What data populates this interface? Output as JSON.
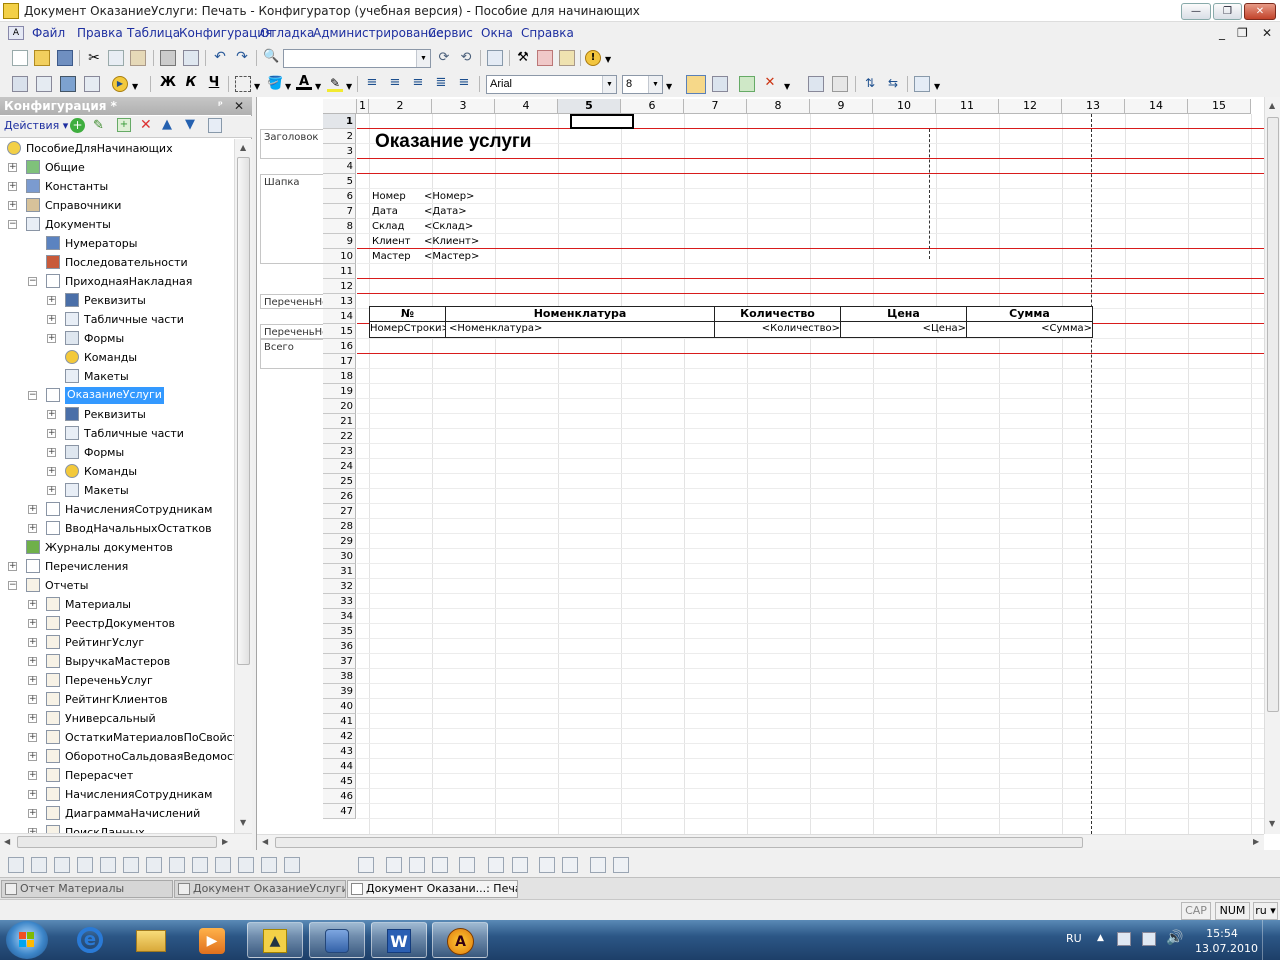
{
  "window": {
    "title": "Документ ОказаниеУслуги: Печать - Конфигуратор (учебная версия) - Пособие для начинающих"
  },
  "menu": [
    "Файл",
    "Правка",
    "Таблица",
    "Конфигурация",
    "Отладка",
    "Администрирование",
    "Сервис",
    "Окна",
    "Справка"
  ],
  "format_toolbar": {
    "font_name": "Arial",
    "font_size": "8",
    "bold": "Ж",
    "italic": "К",
    "underline": "Ч"
  },
  "panel": {
    "title": "Конфигурация *",
    "actions_label": "Действия",
    "tree": [
      {
        "label": "ПособиеДляНачинающих",
        "level": 0,
        "icon": "config-icon"
      },
      {
        "label": "Общие",
        "level": 1,
        "toggle": "+",
        "icon": "common-icon"
      },
      {
        "label": "Константы",
        "level": 1,
        "toggle": "+",
        "icon": "constants-icon"
      },
      {
        "label": "Справочники",
        "level": 1,
        "toggle": "+",
        "icon": "catalogs-icon"
      },
      {
        "label": "Документы",
        "level": 1,
        "toggle": "−",
        "icon": "documents-icon"
      },
      {
        "label": "Нумераторы",
        "level": 2,
        "icon": "numerators-icon"
      },
      {
        "label": "Последовательности",
        "level": 2,
        "icon": "sequences-icon"
      },
      {
        "label": "ПриходнаяНакладная",
        "level": 2,
        "toggle": "−",
        "icon": "document-icon"
      },
      {
        "label": "Реквизиты",
        "level": 3,
        "toggle": "+",
        "icon": "attributes-icon"
      },
      {
        "label": "Табличные части",
        "level": 3,
        "toggle": "+",
        "icon": "tabular-icon"
      },
      {
        "label": "Формы",
        "level": 3,
        "toggle": "+",
        "icon": "forms-icon"
      },
      {
        "label": "Команды",
        "level": 3,
        "icon": "commands-icon"
      },
      {
        "label": "Макеты",
        "level": 3,
        "icon": "templates-icon"
      },
      {
        "label": "ОказаниеУслуги",
        "level": 2,
        "toggle": "−",
        "icon": "document-icon",
        "selected": true
      },
      {
        "label": "Реквизиты",
        "level": 3,
        "toggle": "+",
        "icon": "attributes-icon"
      },
      {
        "label": "Табличные части",
        "level": 3,
        "toggle": "+",
        "icon": "tabular-icon"
      },
      {
        "label": "Формы",
        "level": 3,
        "toggle": "+",
        "icon": "forms-icon"
      },
      {
        "label": "Команды",
        "level": 3,
        "toggle": "+",
        "icon": "commands-icon"
      },
      {
        "label": "Макеты",
        "level": 3,
        "toggle": "+",
        "icon": "templates-icon"
      },
      {
        "label": "НачисленияСотрудникам",
        "level": 2,
        "toggle": "+",
        "icon": "document-icon"
      },
      {
        "label": "ВводНачальныхОстатков",
        "level": 2,
        "toggle": "+",
        "icon": "document-icon"
      },
      {
        "label": "Журналы документов",
        "level": 1,
        "icon": "journals-icon"
      },
      {
        "label": "Перечисления",
        "level": 1,
        "toggle": "+",
        "icon": "enums-icon"
      },
      {
        "label": "Отчеты",
        "level": 1,
        "toggle": "−",
        "icon": "reports-icon"
      },
      {
        "label": "Материалы",
        "level": 2,
        "toggle": "+",
        "icon": "report-icon"
      },
      {
        "label": "РеестрДокументов",
        "level": 2,
        "toggle": "+",
        "icon": "report-icon"
      },
      {
        "label": "РейтингУслуг",
        "level": 2,
        "toggle": "+",
        "icon": "report-icon"
      },
      {
        "label": "ВыручкаМастеров",
        "level": 2,
        "toggle": "+",
        "icon": "report-icon"
      },
      {
        "label": "ПереченьУслуг",
        "level": 2,
        "toggle": "+",
        "icon": "report-icon"
      },
      {
        "label": "РейтингКлиентов",
        "level": 2,
        "toggle": "+",
        "icon": "report-icon"
      },
      {
        "label": "Универсальный",
        "level": 2,
        "toggle": "+",
        "icon": "report-icon"
      },
      {
        "label": "ОстаткиМатериаловПоСвойств...",
        "level": 2,
        "toggle": "+",
        "icon": "report-icon"
      },
      {
        "label": "ОборотноСальдоваяВедомость",
        "level": 2,
        "toggle": "+",
        "icon": "report-icon"
      },
      {
        "label": "Перерасчет",
        "level": 2,
        "toggle": "+",
        "icon": "report-icon"
      },
      {
        "label": "НачисленияСотрудникам",
        "level": 2,
        "toggle": "+",
        "icon": "report-icon"
      },
      {
        "label": "ДиаграммаНачислений",
        "level": 2,
        "toggle": "+",
        "icon": "report-icon"
      },
      {
        "label": "ПоискДанных",
        "level": 2,
        "toggle": "+",
        "icon": "report-icon"
      }
    ]
  },
  "sheet": {
    "columns": [
      "1",
      "2",
      "3",
      "4",
      "5",
      "6",
      "7",
      "8",
      "9",
      "10",
      "11",
      "12",
      "13",
      "14",
      "15"
    ],
    "rows": [
      "1",
      "2",
      "3",
      "4",
      "5",
      "6",
      "7",
      "8",
      "9",
      "10",
      "11",
      "12",
      "13",
      "14",
      "15",
      "16",
      "17",
      "18",
      "19",
      "20",
      "21",
      "22",
      "23",
      "24",
      "25",
      "26",
      "27",
      "28",
      "29",
      "30",
      "31",
      "32",
      "33",
      "34",
      "35",
      "36",
      "37",
      "38",
      "39",
      "40",
      "41",
      "42",
      "43",
      "44",
      "45",
      "46",
      "47"
    ],
    "sections": {
      "header": "Заголовок",
      "cap": "Шапка",
      "list_header": "ПереченьНо",
      "list_row": "ПереченьНо",
      "total": "Всего"
    },
    "doc_title": "Оказание услуги",
    "fields": [
      {
        "label": "Номер",
        "param": "<Номер>"
      },
      {
        "label": "Дата",
        "param": "<Дата>"
      },
      {
        "label": "Склад",
        "param": "<Склад>"
      },
      {
        "label": "Клиент",
        "param": "<Клиент>"
      },
      {
        "label": "Мастер",
        "param": "<Мастер>"
      }
    ],
    "table_headers": [
      "№",
      "Номенклатура",
      "Количество",
      "Цена",
      "Сумма"
    ],
    "table_row": [
      "НомерСтроки>",
      "<Номенклатура>",
      "<Количество>",
      "<Цена>",
      "<Сумма>"
    ]
  },
  "window_tabs": [
    {
      "label": "Отчет Материалы",
      "active": false
    },
    {
      "label": "Документ ОказаниеУслуги",
      "active": false
    },
    {
      "label": "Документ Оказани...: Печать",
      "active": true
    }
  ],
  "status": {
    "cap": "CAP",
    "num": "NUM",
    "lang": "ru"
  },
  "taskbar": {
    "lang": "RU",
    "time": "15:54",
    "date": "13.07.2010"
  }
}
